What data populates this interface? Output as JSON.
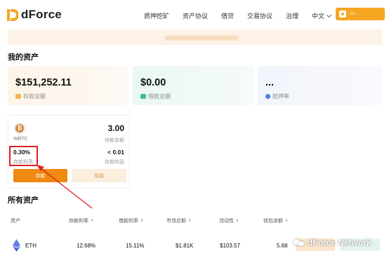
{
  "header": {
    "logo_text": "dForce",
    "nav": [
      "质押挖矿",
      "资产协议",
      "借贷",
      "交易协议",
      "治理"
    ],
    "language": "中文",
    "wallet_address": "0x····"
  },
  "my_assets": {
    "title": "我的资产",
    "cards": [
      {
        "value": "$151,252.11",
        "label": "存款总额",
        "icon": "deposit-icon"
      },
      {
        "value": "$0.00",
        "label": "借款总额",
        "icon": "borrow-icon"
      },
      {
        "value": "...",
        "label": "抵押率",
        "icon": "collateral-icon"
      }
    ]
  },
  "asset_card": {
    "coin_symbol": "WBTC",
    "coin_glyph": "₿",
    "balance": "3.00",
    "balance_label": "存款余额",
    "deposit_rate": "0.30%",
    "deposit_rate_label": "存款利率",
    "interest": "< 0.01",
    "interest_label": "存款利息",
    "deposit_button": "存款",
    "withdraw_button": "取款"
  },
  "all_assets": {
    "title": "所有资产",
    "columns": [
      "资产",
      "存款利率",
      "借款利率",
      "市场总额",
      "流动性",
      "钱包余额"
    ],
    "sort_glyph": "⬍",
    "rows": [
      {
        "asset": "ETH",
        "deposit_rate": "12.68%",
        "borrow_rate": "15.11%",
        "market_size": "$1.81K",
        "liquidity": "$103.57",
        "wallet_balance": "5.68"
      }
    ]
  },
  "watermark": "dForce Network",
  "colors": {
    "brand_orange": "#F5A623",
    "deposit_button": "#EE8A12",
    "highlight_red": "#E02020"
  }
}
